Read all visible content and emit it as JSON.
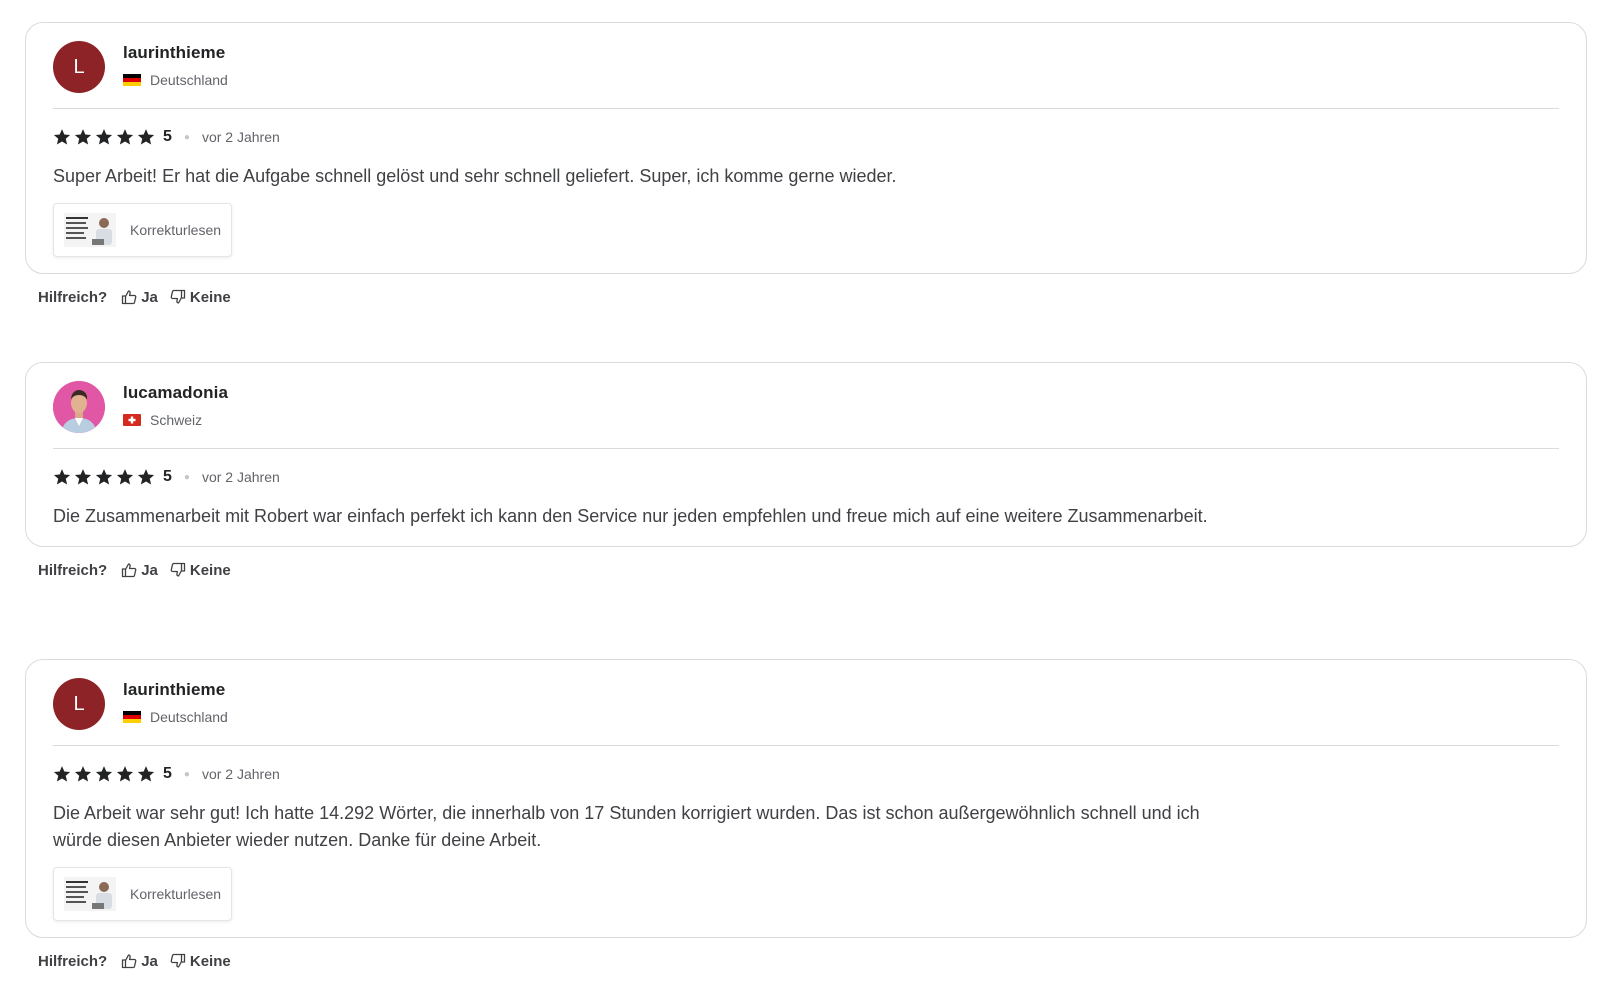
{
  "reviews": [
    {
      "username": "laurinthieme",
      "avatar_letter": "L",
      "avatar_type": "letter",
      "avatar_color": "#8d2326",
      "country": "Deutschland",
      "flag_icon": "germany-flag-icon",
      "rating": "5",
      "stars": 5,
      "time": "vor 2 Jahren",
      "text": "Super Arbeit! Er hat die Aufgabe schnell gelöst und sehr schnell geliefert. Super, ich komme gerne wieder.",
      "gig_label": "Korrekturlesen",
      "helpful_label": "Hilfreich?",
      "yes_label": "Ja",
      "no_label": "Keine"
    },
    {
      "username": "lucamadonia",
      "avatar_type": "photo",
      "avatar_color": "#e157a6",
      "country": "Schweiz",
      "flag_icon": "switzerland-flag-icon",
      "rating": "5",
      "stars": 5,
      "time": "vor 2 Jahren",
      "text": "Die Zusammenarbeit mit Robert war einfach perfekt ich kann den Service nur jeden empfehlen und freue mich auf eine weitere Zusammenarbeit.",
      "helpful_label": "Hilfreich?",
      "yes_label": "Ja",
      "no_label": "Keine"
    },
    {
      "username": "laurinthieme",
      "avatar_letter": "L",
      "avatar_type": "letter",
      "avatar_color": "#8d2326",
      "country": "Deutschland",
      "flag_icon": "germany-flag-icon",
      "rating": "5",
      "stars": 5,
      "time": "vor 2 Jahren",
      "text": "Die Arbeit war sehr gut! Ich hatte 14.292 Wörter, die innerhalb von 17 Stunden korrigiert wurden. Das ist schon außergewöhnlich schnell und ich würde diesen Anbieter wieder nutzen. Danke für deine Arbeit.",
      "gig_label": "Korrekturlesen",
      "helpful_label": "Hilfreich?",
      "yes_label": "Ja",
      "no_label": "Keine"
    }
  ]
}
